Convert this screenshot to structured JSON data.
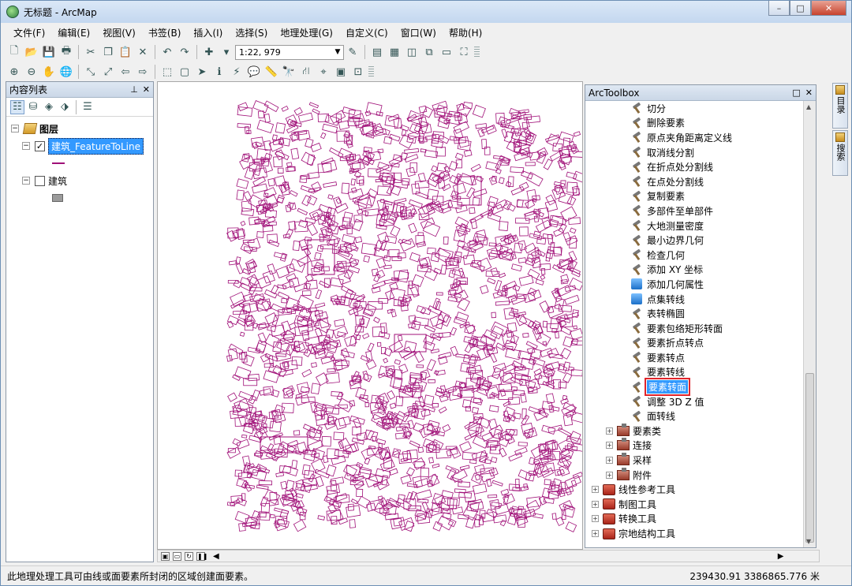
{
  "window": {
    "title": "无标题 - ArcMap",
    "minimize": "–",
    "maximize": "□",
    "close": "✕"
  },
  "menu": [
    "文件(F)",
    "编辑(E)",
    "视图(V)",
    "书签(B)",
    "插入(I)",
    "选择(S)",
    "地理处理(G)",
    "自定义(C)",
    "窗口(W)",
    "帮助(H)"
  ],
  "toolbar": {
    "scale": "1:22, 979"
  },
  "toc": {
    "title": "内容列表",
    "pin": "⊥",
    "close": "✕",
    "root": "图层",
    "layers": [
      {
        "name": "建筑_FeatureToLine",
        "checked": true,
        "selected": true,
        "symbol": "line"
      },
      {
        "name": "建筑",
        "checked": false,
        "selected": false,
        "symbol": "polygon"
      }
    ]
  },
  "toolbox": {
    "title": "ArcToolbox",
    "float": "□",
    "close": "✕",
    "tools": [
      "切分",
      "删除要素",
      "原点夹角距离定义线",
      "取消线分割",
      "在折点处分割线",
      "在点处分割线",
      "复制要素",
      "多部件至单部件",
      "大地测量密度",
      "最小边界几何",
      "检查几何",
      "添加 XY 坐标",
      "添加几何属性",
      "点集转线",
      "表转椭圆",
      "要素包络矩形转面",
      "要素折点转点",
      "要素转点",
      "要素转线",
      "要素转面",
      "调整 3D Z 值",
      "面转线"
    ],
    "script_tools": [
      "添加几何属性",
      "点集转线"
    ],
    "selected_tool": "要素转面",
    "toolsets": [
      "要素类",
      "连接",
      "采样",
      "附件"
    ],
    "toolboxes": [
      "线性参考工具",
      "制图工具",
      "转换工具",
      "宗地结构工具"
    ]
  },
  "side_tabs": [
    "目录",
    "搜索"
  ],
  "colors": {
    "feature_line": "#a01078",
    "selection": "#3399ff",
    "highlight_box": "#e0242b"
  },
  "status": {
    "message": "此地理处理工具可由线或面要素所封闭的区域创建面要素。",
    "coordinates": "239430.91   3386865.776 米"
  }
}
